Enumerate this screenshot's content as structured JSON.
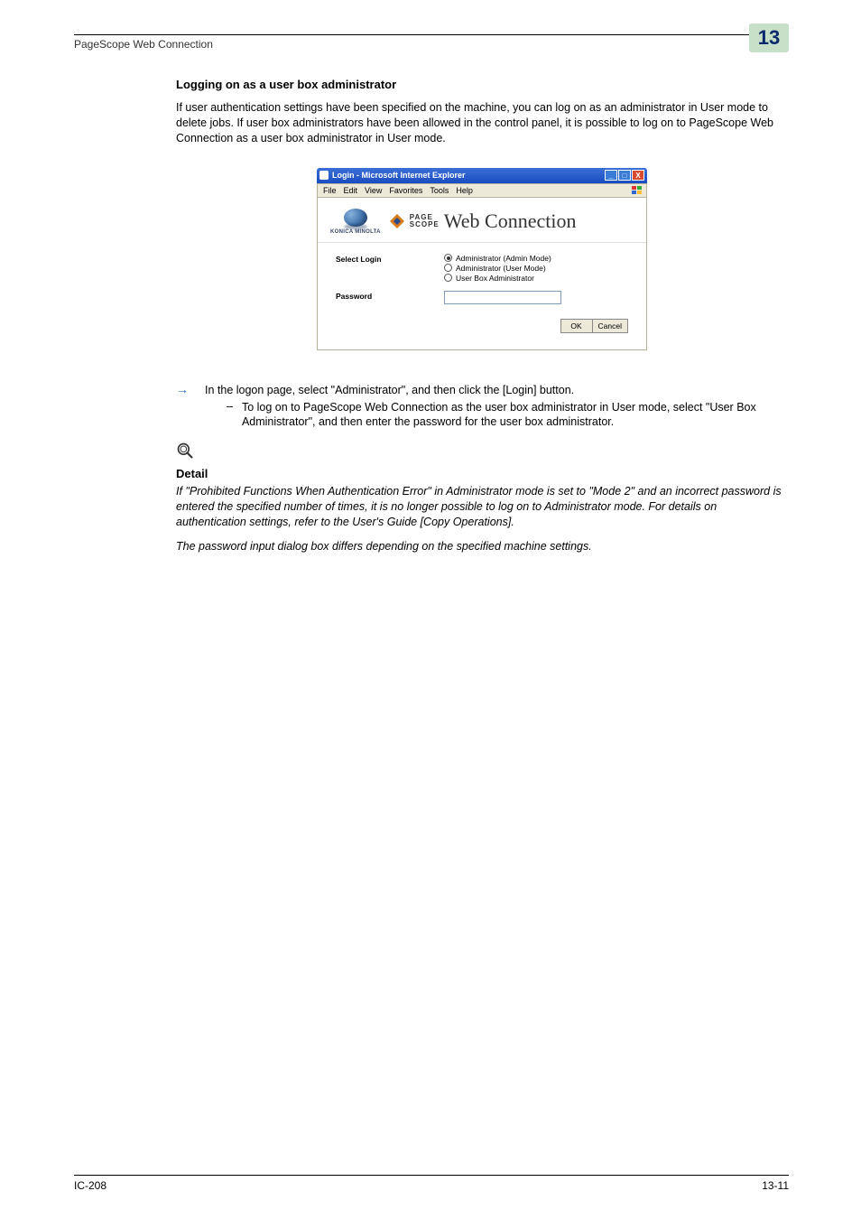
{
  "header": {
    "breadcrumb": "PageScope Web Connection",
    "chapter": "13"
  },
  "section": {
    "title": "Logging on as a user box administrator",
    "intro": "If user authentication settings have been specified on the machine, you can log on as an administrator in User mode to delete jobs. If user box administrators have been allowed in the control panel, it is possible to log on to PageScope Web Connection as a user box administrator in User mode."
  },
  "screenshot": {
    "window_title": "Login - Microsoft Internet Explorer",
    "menus": {
      "file": "File",
      "edit": "Edit",
      "view": "View",
      "favorites": "Favorites",
      "tools": "Tools",
      "help": "Help"
    },
    "brand": {
      "km": "KONICA MINOLTA",
      "p1": "PAGE",
      "p2": "SCOPE",
      "rest": "Web Connection"
    },
    "form": {
      "select_label": "Select Login",
      "opt_admin_admin": "Administrator (Admin Mode)",
      "opt_admin_user": "Administrator (User Mode)",
      "opt_box_admin": "User Box Administrator",
      "password_label": "Password",
      "ok": "OK",
      "cancel": "Cancel"
    }
  },
  "instruction": {
    "main": "In the logon page, select \"Administrator\", and then click the [Login] button.",
    "sub": "To log on to PageScope Web Connection as the user box administrator in User mode, select \"User Box Administrator\", and then enter the password for the user box administrator."
  },
  "detail": {
    "label": "Detail",
    "p1": "If \"Prohibited Functions When Authentication Error\" in Administrator mode is set to \"Mode 2\" and an incorrect password is entered the specified number of times, it is no longer possible to log on to Administrator mode. For details on authentication settings, refer to the User's Guide [Copy Operations].",
    "p2": "The password input dialog box differs depending on the specified machine settings."
  },
  "footer": {
    "left": "IC-208",
    "right": "13-11"
  }
}
